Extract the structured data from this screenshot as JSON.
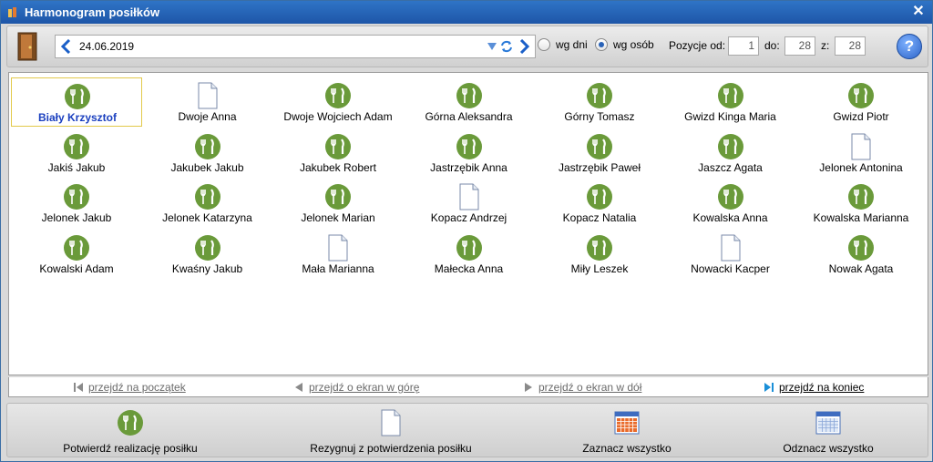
{
  "window": {
    "title": "Harmonogram posiłków",
    "close_glyph": "✕"
  },
  "toolbar": {
    "date": "24.06.2019",
    "radio_days_label": "wg dni",
    "radio_people_label": "wg osób",
    "positions_label": "Pozycje od:",
    "to_label": "do:",
    "of_label": "z:",
    "from_value": "1",
    "to_value": "28",
    "total_value": "28",
    "help_glyph": "?"
  },
  "people": [
    {
      "name": "Biały Krzysztof",
      "icon": "meal-icon",
      "selected": true
    },
    {
      "name": "Dwoje Anna",
      "icon": "document-icon"
    },
    {
      "name": "Dwoje Wojciech Adam",
      "icon": "meal-icon"
    },
    {
      "name": "Górna Aleksandra",
      "icon": "meal-icon"
    },
    {
      "name": "Górny Tomasz",
      "icon": "meal-icon"
    },
    {
      "name": "Gwizd Kinga Maria",
      "icon": "meal-icon"
    },
    {
      "name": "Gwizd Piotr",
      "icon": "meal-icon"
    },
    {
      "name": "Jakiś Jakub",
      "icon": "meal-icon"
    },
    {
      "name": "Jakubek Jakub",
      "icon": "meal-icon"
    },
    {
      "name": "Jakubek Robert",
      "icon": "meal-icon"
    },
    {
      "name": "Jastrzębik Anna",
      "icon": "meal-icon"
    },
    {
      "name": "Jastrzębik Paweł",
      "icon": "meal-icon"
    },
    {
      "name": "Jaszcz  Agata",
      "icon": "meal-icon"
    },
    {
      "name": "Jelonek Antonina",
      "icon": "document-icon"
    },
    {
      "name": "Jelonek Jakub",
      "icon": "meal-icon"
    },
    {
      "name": "Jelonek Katarzyna",
      "icon": "meal-icon"
    },
    {
      "name": "Jelonek Marian",
      "icon": "meal-icon"
    },
    {
      "name": "Kopacz Andrzej",
      "icon": "document-icon"
    },
    {
      "name": "Kopacz Natalia",
      "icon": "meal-icon"
    },
    {
      "name": "Kowalska Anna",
      "icon": "meal-icon"
    },
    {
      "name": "Kowalska Marianna",
      "icon": "meal-icon"
    },
    {
      "name": "Kowalski Adam",
      "icon": "meal-icon"
    },
    {
      "name": "Kwaśny Jakub",
      "icon": "meal-icon"
    },
    {
      "name": "Mała Marianna",
      "icon": "document-icon"
    },
    {
      "name": "Małecka Anna",
      "icon": "meal-icon"
    },
    {
      "name": "Miły Leszek",
      "icon": "meal-icon"
    },
    {
      "name": "Nowacki Kacper",
      "icon": "document-icon"
    },
    {
      "name": "Nowak Agata",
      "icon": "meal-icon"
    }
  ],
  "navigation": {
    "first": "przejdź na początek",
    "page_up": "przejdź o ekran w górę",
    "page_down": "przejdź o ekran w dół",
    "last": "przejdź na koniec"
  },
  "actions": {
    "confirm": "Potwierdź realizację posiłku",
    "resign": "Rezygnuj z potwierdzenia posiłku",
    "select_all": "Zaznacz wszystko",
    "deselect_all": "Odznacz wszystko"
  },
  "colors": {
    "meal_green": "#6a9a3a",
    "title_blue": "#1e56a8",
    "selected_text": "#1a3fbf",
    "nav_blue": "#1a5fc8"
  }
}
